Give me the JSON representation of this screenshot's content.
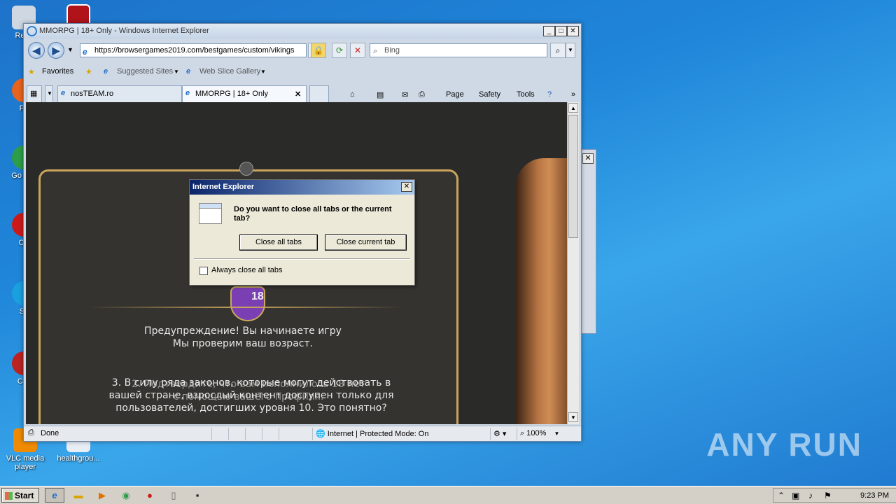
{
  "desktop": {
    "icons": [
      {
        "label": "Recy",
        "color": "#cfd8e2"
      },
      {
        "label": "Fir",
        "color": "#e8641e"
      },
      {
        "label": "Go Chr",
        "color": "#2e9d4a"
      },
      {
        "label": "Op",
        "color": "#cc1a1a"
      },
      {
        "label": "Sk",
        "color": "#1aa0e0"
      },
      {
        "label": "CCl",
        "color": "#b22"
      },
      {
        "label": "VLC media player",
        "color": "#f08a00"
      },
      {
        "label": "healthgrou...",
        "color": "#e8eef5"
      }
    ],
    "watermark": "ANY RUN"
  },
  "ie": {
    "title": "MMORPG | 18+ Only - Windows Internet Explorer",
    "buttons": {
      "minimize": "_",
      "maximize": "□",
      "close": "✕"
    },
    "nav": {
      "back": "◀",
      "forward": "▶"
    },
    "address": "https://browsergames2019.com/bestgames/custom/vikings",
    "search_placeholder": "Bing",
    "favorites": {
      "label": "Favorites",
      "suggested": "Suggested Sites",
      "webslice": "Web Slice Gallery"
    },
    "tabs": [
      {
        "label": "nosTEAM.ro"
      },
      {
        "label": "MMORPG | 18+ Only"
      }
    ],
    "tab_close": "✕",
    "commands": {
      "page": "Page",
      "safety": "Safety",
      "tools": "Tools"
    },
    "content": {
      "badge": "18",
      "text_lines_a": [
        "Предупреждение! Вы начинаете игру",
        "Мы проверим ваш возраст."
      ],
      "text_lines_b": [
        "3. В силу ряда законов, которые могут действовать в",
        "вашей стране, взрослый контент доступен только для",
        "пользователей, достигших уровня 10. Это понятно?"
      ],
      "text_lines_c": [
        "2. Подтвердите, что вам исполнилось 18 лет",
        "с помощью вашего профиля."
      ]
    },
    "status": {
      "done": "Done",
      "zone": "Internet | Protected Mode: On",
      "zoom": "100%"
    }
  },
  "dialog": {
    "title": "Internet Explorer",
    "close": "✕",
    "message": "Do you want to close all tabs or the current tab?",
    "close_all": "Close all tabs",
    "close_current": "Close current tab",
    "checkbox_label": "Always close all tabs"
  },
  "taskbar": {
    "start": "Start",
    "clock": "9:23 PM"
  }
}
